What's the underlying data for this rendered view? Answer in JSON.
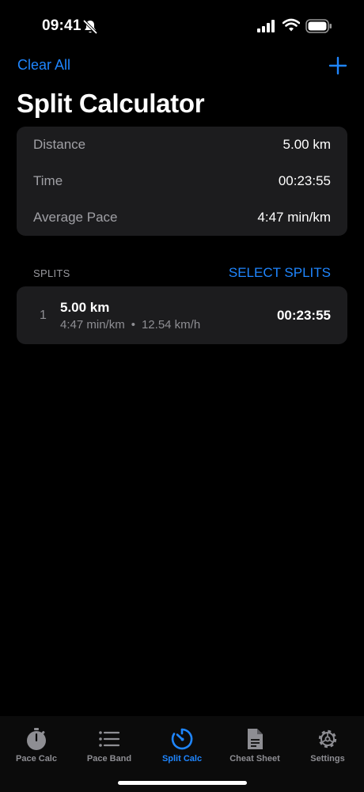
{
  "status_bar": {
    "time": "09:41"
  },
  "nav": {
    "clear_all": "Clear All"
  },
  "title": "Split Calculator",
  "summary": [
    {
      "label": "Distance",
      "value": "5.00 km"
    },
    {
      "label": "Time",
      "value": "00:23:55"
    },
    {
      "label": "Average Pace",
      "value": "4:47 min/km"
    }
  ],
  "splits": {
    "header": "SPLITS",
    "select_label": "SELECT SPLITS",
    "items": [
      {
        "index": "1",
        "distance": "5.00 km",
        "pace": "4:47 min/km",
        "speed": "12.54 km/h",
        "time": "00:23:55"
      }
    ]
  },
  "tabs": [
    {
      "label": "Pace Calc",
      "icon": "stopwatch-icon"
    },
    {
      "label": "Pace Band",
      "icon": "list-icon"
    },
    {
      "label": "Split Calc",
      "icon": "timer-icon",
      "active": true
    },
    {
      "label": "Cheat Sheet",
      "icon": "document-icon"
    },
    {
      "label": "Settings",
      "icon": "gear-icon"
    }
  ],
  "colors": {
    "accent": "#1f86ff",
    "background": "#000000",
    "card": "#1c1c1e",
    "secondary_text": "#8e8e93"
  }
}
